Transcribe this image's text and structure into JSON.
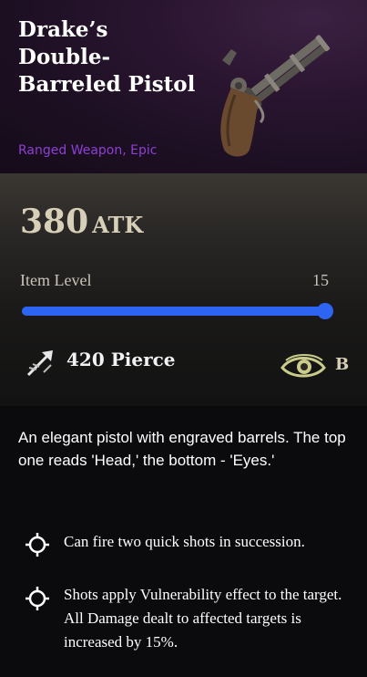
{
  "item": {
    "title": "Drake’s Double-Barreled Pistol",
    "subtitle": "Ranged Weapon, Epic",
    "rarity_color": "#8e3fd6"
  },
  "stats": {
    "atk_value": "380",
    "atk_unit": "ATK",
    "level_label": "Item Level",
    "level_value": "15",
    "level_fill_fraction": 1.0,
    "pierce_text": "420 Pierce",
    "pierce_icon": "arrow-pierce-icon",
    "perception_icon": "eye-icon",
    "grade": "B",
    "accent_color": "#2d64f2"
  },
  "description": "An elegant pistol with engraved barrels. The top one reads 'Head,' the bottom - 'Eyes.'",
  "effects": [
    {
      "text": "Can fire two quick shots in succession.",
      "icon": "crosshair-icon"
    },
    {
      "text": "Shots apply Vulnerability effect to the target. All Damage dealt to affected targets is increased by 15%.",
      "icon": "crosshair-icon"
    }
  ]
}
